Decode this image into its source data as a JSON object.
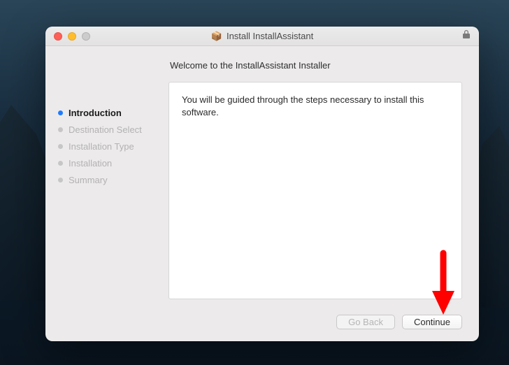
{
  "titlebar": {
    "title": "Install InstallAssistant",
    "package_icon": "📦"
  },
  "sidebar": {
    "steps": [
      {
        "label": "Introduction",
        "active": true
      },
      {
        "label": "Destination Select",
        "active": false
      },
      {
        "label": "Installation Type",
        "active": false
      },
      {
        "label": "Installation",
        "active": false
      },
      {
        "label": "Summary",
        "active": false
      }
    ]
  },
  "main": {
    "heading": "Welcome to the InstallAssistant Installer",
    "body_text": "You will be guided through the steps necessary to install this software."
  },
  "footer": {
    "go_back_label": "Go Back",
    "continue_label": "Continue"
  }
}
